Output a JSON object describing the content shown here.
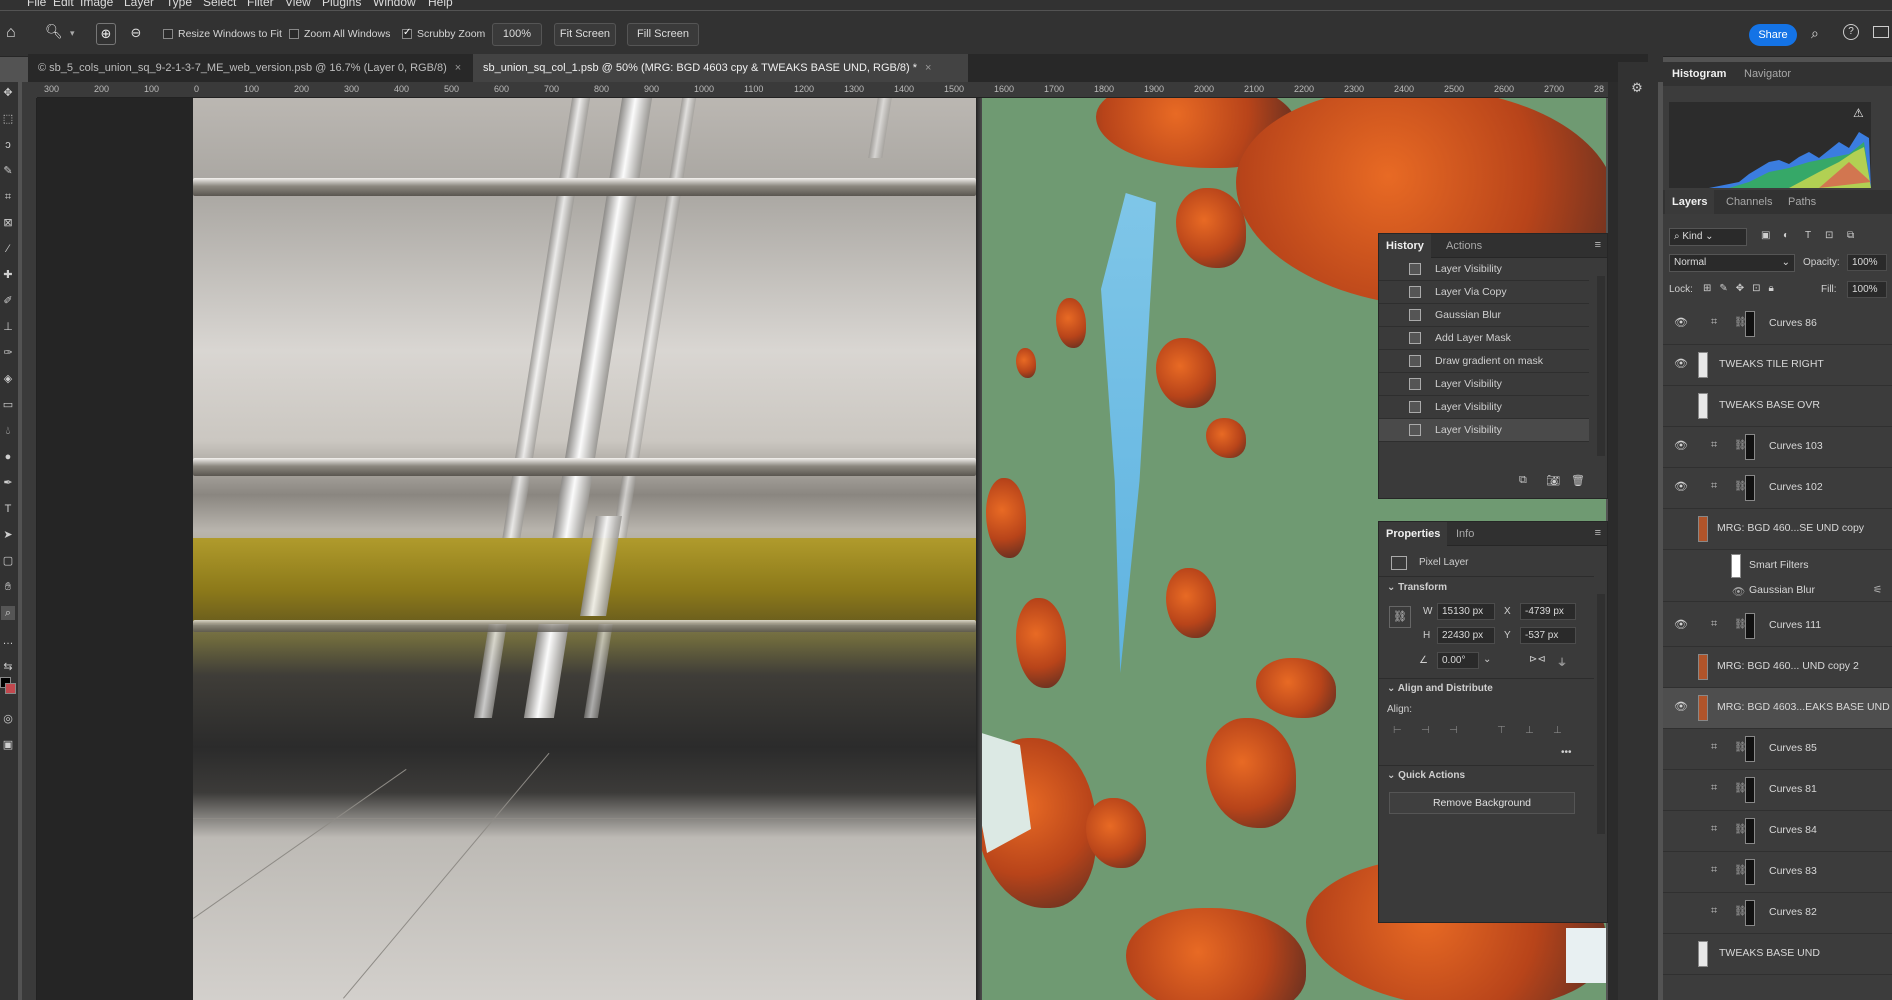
{
  "menubar": {
    "items": [
      "File",
      "Edit",
      "Image",
      "Layer",
      "Type",
      "Select",
      "Filter",
      "View",
      "Plugins",
      "Window",
      "Help"
    ]
  },
  "options": {
    "resize_windows": "Resize Windows to Fit",
    "zoom_all": "Zoom All Windows",
    "scrubby": "Scrubby Zoom",
    "zoom_value": "100%",
    "fit_screen": "Fit Screen",
    "fill_screen": "Fill Screen",
    "share": "Share"
  },
  "tabs": [
    {
      "label": "© sb_5_cols_union_sq_9-2-1-3-7_ME_web_version.psb @ 16.7% (Layer 0, RGB/8)",
      "close": "×"
    },
    {
      "label": "sb_union_sq_col_1.psb @ 50% (MRG: BGD 4603 cpy & TWEAKS BASE UND, RGB/8) *",
      "close": "×"
    }
  ],
  "ruler_ticks": [
    "300",
    "200",
    "100",
    "0",
    "100",
    "200",
    "300",
    "400",
    "500",
    "600",
    "700",
    "800",
    "900",
    "1000",
    "1100",
    "1200",
    "1300",
    "1400",
    "1500",
    "1600",
    "1700",
    "1800",
    "1900",
    "2000",
    "2100",
    "2200",
    "2300",
    "2400",
    "2500",
    "2600",
    "2700",
    "28"
  ],
  "history": {
    "tabs": [
      "History",
      "Actions"
    ],
    "items": [
      "Layer Visibility",
      "Layer Via Copy",
      "Gaussian Blur",
      "Add Layer Mask",
      "Draw gradient on mask",
      "Layer Visibility",
      "Layer Visibility",
      "Layer Visibility"
    ],
    "selected_index": 7
  },
  "properties": {
    "tabs": [
      "Properties",
      "Info"
    ],
    "kind": "Pixel Layer",
    "transform_title": "Transform",
    "w_label": "W",
    "w": "15130 px",
    "x_label": "X",
    "x": "-4739 px",
    "h_label": "H",
    "h": "22430 px",
    "y_label": "Y",
    "y": "-537 px",
    "angle": "0.00°",
    "align_title": "Align and Distribute",
    "align_label": "Align:",
    "quick_title": "Quick Actions",
    "remove_bg": "Remove Background"
  },
  "histogram": {
    "tabs": [
      "Histogram",
      "Navigator"
    ]
  },
  "layers_panel": {
    "tabs": [
      "Layers",
      "Channels",
      "Paths"
    ],
    "kind": "Kind",
    "blend": "Normal",
    "opacity_label": "Opacity:",
    "opacity": "100%",
    "lock_label": "Lock:",
    "fill_label": "Fill:",
    "fill": "100%",
    "layers": [
      {
        "name": "Curves 86",
        "visible": true,
        "type": "adj"
      },
      {
        "name": "TWEAKS TILE RIGHT",
        "visible": true,
        "type": "pix"
      },
      {
        "name": "TWEAKS BASE OVR",
        "visible": false,
        "type": "pix"
      },
      {
        "name": "Curves 103",
        "visible": true,
        "type": "adj"
      },
      {
        "name": "Curves 102",
        "visible": true,
        "type": "adj"
      },
      {
        "name": "MRG: BGD 460...SE UND copy",
        "visible": false,
        "type": "smart"
      },
      {
        "name": "Curves 111",
        "visible": true,
        "type": "adj"
      },
      {
        "name": "MRG: BGD 460... UND copy 2",
        "visible": false,
        "type": "smart"
      },
      {
        "name": "MRG: BGD 4603...EAKS BASE UND",
        "visible": true,
        "type": "smart",
        "selected": true
      },
      {
        "name": "Curves 85",
        "visible": false,
        "type": "adj"
      },
      {
        "name": "Curves 81",
        "visible": false,
        "type": "adj"
      },
      {
        "name": "Curves 84",
        "visible": false,
        "type": "adj"
      },
      {
        "name": "Curves 83",
        "visible": false,
        "type": "adj"
      },
      {
        "name": "Curves 82",
        "visible": false,
        "type": "adj"
      },
      {
        "name": "TWEAKS BASE UND",
        "visible": false,
        "type": "pix"
      }
    ],
    "smart_filters": "Smart Filters",
    "gaussian": "Gaussian Blur"
  },
  "colors": {
    "accent": "#1473e6",
    "selected_row": "#4e4e4e"
  }
}
